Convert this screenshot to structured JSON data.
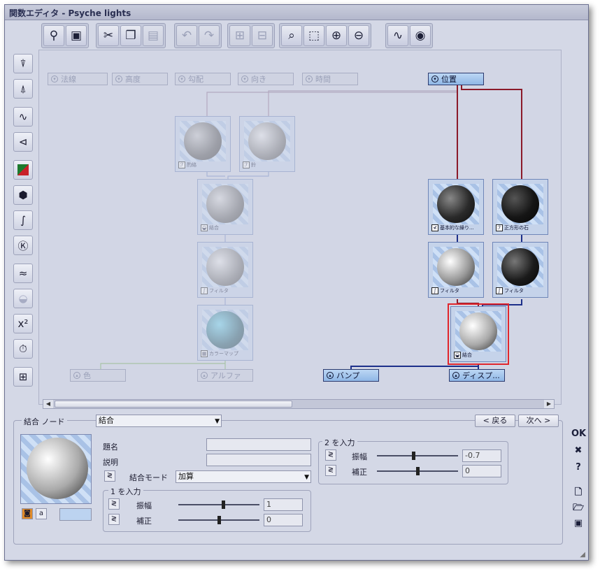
{
  "window": {
    "title": "関数エディタ - Psyche lights"
  },
  "toolbar": {
    "groups": [
      [
        "hierarchy-icon",
        "node-panel-icon"
      ],
      [
        "cut-icon",
        "copy-icon",
        "paste-icon"
      ],
      [
        "undo-icon",
        "redo-icon"
      ],
      [
        "expand-tree-icon",
        "collapse-tree-icon"
      ],
      [
        "zoom-fit-icon",
        "zoom-region-icon",
        "zoom-in-icon",
        "zoom-out-icon"
      ],
      [
        "graph-view-icon",
        "render-preview-icon"
      ]
    ]
  },
  "sidebar": [
    "input-node-icon",
    "output-node-icon",
    "wave-icon",
    "connect-icon",
    "color-icon",
    "shape-icon",
    "curve-icon",
    "key-icon",
    "noise-icon",
    "combine-icon",
    "power-icon",
    "timer-icon",
    "tree-icon"
  ],
  "ports_top": [
    {
      "label": "法線",
      "active": false
    },
    {
      "label": "高度",
      "active": false
    },
    {
      "label": "勾配",
      "active": false
    },
    {
      "label": "向き",
      "active": false
    },
    {
      "label": "時間",
      "active": false
    },
    {
      "label": "位置",
      "active": true
    }
  ],
  "ports_bottom": [
    {
      "label": "色",
      "active": false
    },
    {
      "label": "アルファ",
      "active": false
    },
    {
      "label": "バンプ",
      "active": true
    },
    {
      "label": "ディスプ...",
      "active": true
    }
  ],
  "nodes": [
    {
      "id": "n1",
      "label": "酌絡",
      "icon": "ℱ",
      "dim": true
    },
    {
      "id": "n2",
      "label": "鈴",
      "icon": "ℱ",
      "dim": true
    },
    {
      "id": "n3",
      "label": "結合",
      "icon": "◒",
      "dim": true
    },
    {
      "id": "n4",
      "label": "フィルタ",
      "icon": "∫",
      "dim": true
    },
    {
      "id": "n5",
      "label": "カラーマップ",
      "icon": "▦",
      "dim": true
    },
    {
      "id": "n6",
      "label": "基本的な繰り...",
      "icon": "≮",
      "dim": false
    },
    {
      "id": "n7",
      "label": "正方形の石",
      "icon": "ℱ",
      "dim": false
    },
    {
      "id": "n8",
      "label": "フィルタ",
      "icon": "∫",
      "dim": false
    },
    {
      "id": "n9",
      "label": "フィルタ",
      "icon": "∫",
      "dim": false
    },
    {
      "id": "n10",
      "label": "結合",
      "icon": "◒",
      "dim": false,
      "selected": true
    }
  ],
  "bottom": {
    "node_type_label": "結合 ノード",
    "node_type_value": "結合",
    "back": "< 戻る",
    "next": "次へ >",
    "title_label": "題名",
    "desc_label": "説明",
    "mode_label": "結合モード",
    "mode_value": "加算",
    "input1": {
      "group": "1 を入力",
      "amp_label": "振幅",
      "amp": "1",
      "offset_label": "補正",
      "offset": "0"
    },
    "input2": {
      "group": "2 を入力",
      "amp_label": "振幅",
      "amp": "-0.7",
      "offset_label": "補正",
      "offset": "0"
    }
  },
  "right_buttons": {
    "ok": "OK",
    "cancel": "✖",
    "help": "?"
  },
  "colors": {
    "link_red": "#8b1a2a",
    "link_blue": "#1c2f8a",
    "selection": "#e0262c"
  }
}
